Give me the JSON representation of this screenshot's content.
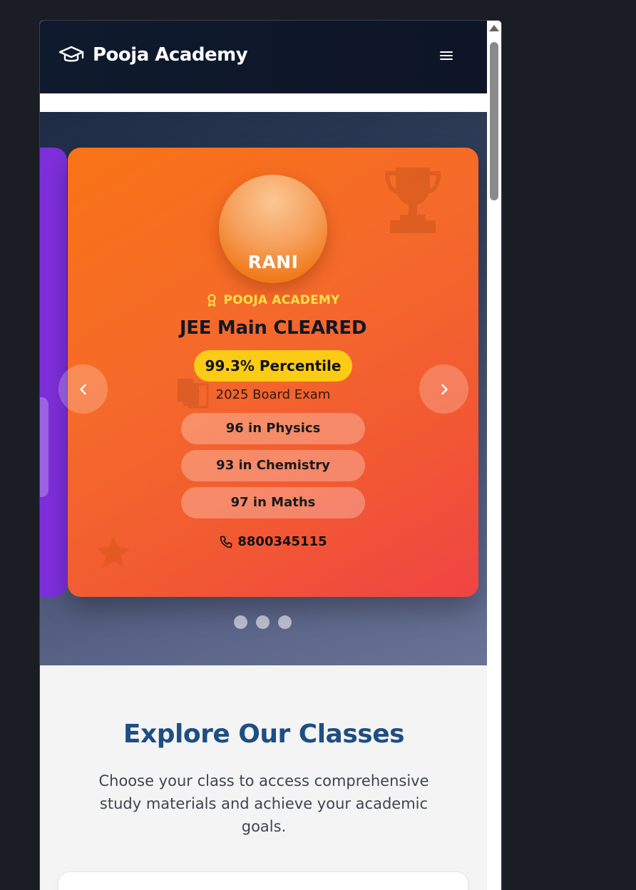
{
  "header": {
    "brand_name": "Pooja Academy",
    "brand_icon": "graduation-cap-icon",
    "menu_icon": "hamburger-menu-icon"
  },
  "hero": {
    "student": {
      "name": "RANI",
      "academy": "POOJA ACADEMY",
      "academy_icon": "award-ribbon-icon",
      "exam_result": "JEE Main CLEARED",
      "score": "99.3% Percentile",
      "board_exam": "2025 Board Exam",
      "subjects": [
        "96 in Physics",
        "93 in Chemistry",
        "97 in Maths"
      ],
      "phone": "8800345115",
      "phone_icon": "phone-icon"
    },
    "carousel": {
      "prev_icon": "chevron-left-icon",
      "next_icon": "chevron-right-icon",
      "slide_count": 3
    }
  },
  "classes": {
    "title": "Explore Our Classes",
    "subtitle": "Choose your class to access comprehensive study materials and achieve your academic goals."
  },
  "colors": {
    "nav_bg": "#0f1a2e",
    "card_orange": "#f97316",
    "card_red": "#ef4444",
    "card_purple": "#7e2fdc",
    "accent_yellow": "#facc15",
    "academy_yellow": "#fde047",
    "title_blue": "#1e4e83"
  }
}
